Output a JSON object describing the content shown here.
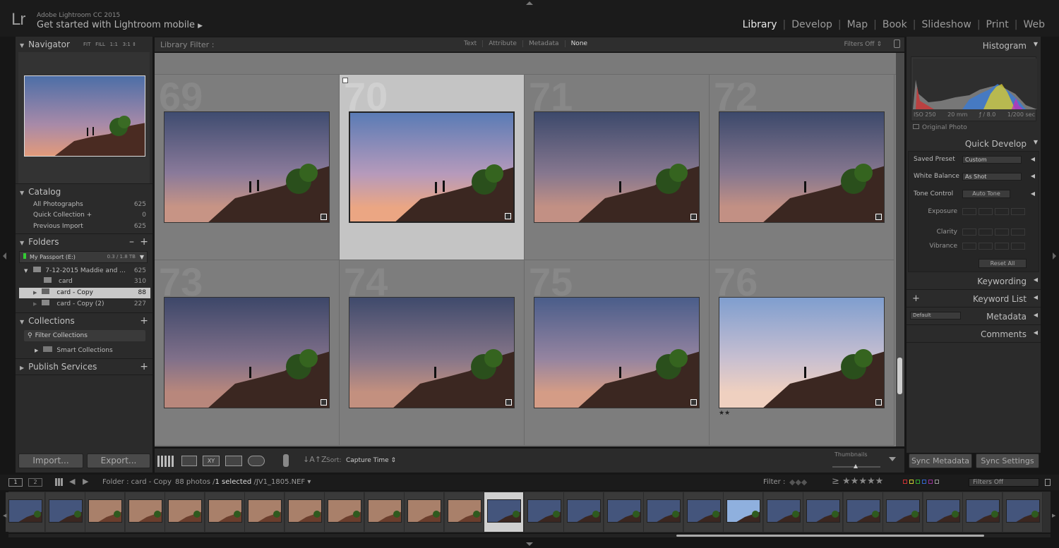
{
  "app": {
    "logo": "Lr",
    "identity_line1": "Adobe Lightroom CC 2015",
    "identity_line2": "Get started with Lightroom mobile",
    "identity_arrow": "▶"
  },
  "modules": [
    "Library",
    "Develop",
    "Map",
    "Book",
    "Slideshow",
    "Print",
    "Web"
  ],
  "active_module": "Library",
  "navigator": {
    "title": "Navigator",
    "fit": "FIT",
    "fill": "FILL",
    "r1": "1:1",
    "r3": "3:1"
  },
  "catalog": {
    "title": "Catalog",
    "items": [
      {
        "label": "All Photographs",
        "count": "625"
      },
      {
        "label": "Quick Collection +",
        "count": "0"
      },
      {
        "label": "Previous Import",
        "count": "625"
      }
    ]
  },
  "folders": {
    "title": "Folders",
    "minus": "–",
    "plus": "+",
    "drive": {
      "label": "My Passport (E:)",
      "size": "0.3 / 1.8 TB"
    },
    "items": [
      {
        "label": "7-12-2015 Maddie and ...",
        "count": "625"
      },
      {
        "label": "card",
        "count": "310"
      },
      {
        "label": "card - Copy",
        "count": "88"
      },
      {
        "label": "card - Copy (2)",
        "count": "227"
      }
    ]
  },
  "collections": {
    "title": "Collections",
    "plus": "+",
    "filter_placeholder": "Filter Collections",
    "smart": "Smart Collections"
  },
  "publish": {
    "title": "Publish Services",
    "plus": "+"
  },
  "left_buttons": {
    "import": "Import...",
    "export": "Export..."
  },
  "filterbar": {
    "label": "Library Filter :",
    "tabs": [
      "Text",
      "Attribute",
      "Metadata",
      "None"
    ],
    "active": "None",
    "preset": "Filters Off"
  },
  "grid": {
    "cells": [
      {
        "num": "69",
        "selected": false,
        "stars": ""
      },
      {
        "num": "70",
        "selected": true,
        "stars": ""
      },
      {
        "num": "71",
        "selected": false,
        "stars": ""
      },
      {
        "num": "72",
        "selected": false,
        "stars": ""
      },
      {
        "num": "73",
        "selected": false,
        "stars": ""
      },
      {
        "num": "74",
        "selected": false,
        "stars": ""
      },
      {
        "num": "75",
        "selected": false,
        "stars": ""
      },
      {
        "num": "76",
        "selected": false,
        "stars": "★★"
      }
    ]
  },
  "toolbar": {
    "sort_label": "Sort:",
    "sort_value": "Capture Time",
    "thumb_label": "Thumbnails"
  },
  "histogram": {
    "title": "Histogram",
    "iso": "ISO 250",
    "focal": "20 mm",
    "aperture": "ƒ / 8.0",
    "shutter": "1/200 sec",
    "original": "Original Photo"
  },
  "quick_develop": {
    "title": "Quick Develop",
    "saved_preset_label": "Saved Preset",
    "saved_preset_value": "Custom",
    "wb_label": "White Balance",
    "wb_value": "As Shot",
    "tone_label": "Tone Control",
    "auto_tone": "Auto Tone",
    "exposure": "Exposure",
    "clarity": "Clarity",
    "vibrance": "Vibrance",
    "reset": "Reset All"
  },
  "right_sections": {
    "keywording": "Keywording",
    "keyword_list": "Keyword List",
    "metadata": "Metadata",
    "metadata_preset": "Default",
    "comments": "Comments",
    "plus": "+"
  },
  "right_buttons": {
    "sync_metadata": "Sync Metadata",
    "sync_settings": "Sync Settings"
  },
  "filmstrip_bar": {
    "page1": "1",
    "page2": "2",
    "source": "Folder : card - Copy",
    "count": "88 photos /",
    "selected": "1 selected",
    "filename": "/JV1_1805.NEF",
    "filter_label": "Filter :",
    "filter_preset": "Filters Off",
    "stars": "★★★★★"
  },
  "colors": {
    "accent_flags": [
      "#c33",
      "#cc3",
      "#3a3",
      "#36c",
      "#939",
      "#999"
    ]
  }
}
